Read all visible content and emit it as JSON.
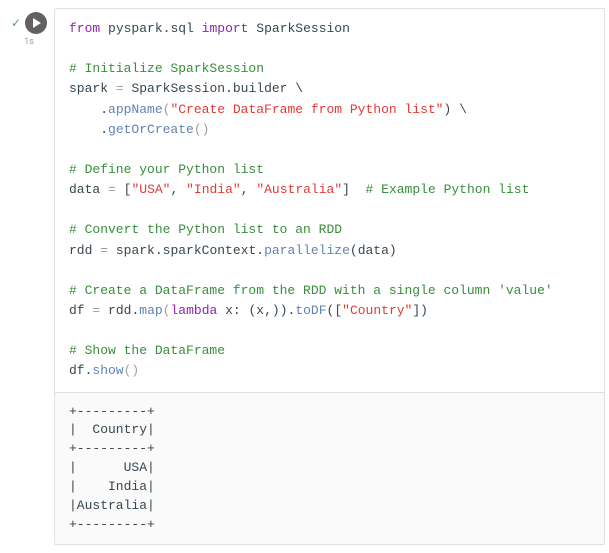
{
  "cell": {
    "exec_time": "1s",
    "code": {
      "l1": {
        "kw_from": "from",
        "mod1": "pyspark.sql",
        "kw_import": "import",
        "cls": "SparkSession"
      },
      "l3": {
        "comment": "# Initialize SparkSession"
      },
      "l4": {
        "var": "spark",
        "op": "=",
        "chain": "SparkSession.builder \\"
      },
      "l5": {
        "indent": "    .",
        "meth": "appName",
        "str": "\"Create DataFrame from Python list\"",
        "tail": ") \\"
      },
      "l6": {
        "indent": "    .",
        "meth": "getOrCreate",
        "parens": "()"
      },
      "l8": {
        "comment": "# Define your Python list"
      },
      "l9": {
        "var": "data",
        "op": "=",
        "lb": "[",
        "s1": "\"USA\"",
        "c1": ", ",
        "s2": "\"India\"",
        "c2": ", ",
        "s3": "\"Australia\"",
        "rb": "]",
        "comment": "  # Example Python list"
      },
      "l11": {
        "comment": "# Convert the Python list to an RDD"
      },
      "l12": {
        "var": "rdd",
        "op": "=",
        "obj": "spark.sparkContext.",
        "meth": "parallelize",
        "arg": "(data)"
      },
      "l14": {
        "comment": "# Create a DataFrame from the RDD with a single column 'value'"
      },
      "l15": {
        "var": "df",
        "op": "=",
        "obj": "rdd.",
        "m1": "map",
        "lp": "(",
        "kw": "lambda",
        "lam": " x: (x,)).",
        "m2": "toDF",
        "arg2": "([",
        "str": "\"Country\"",
        "arg3": "])"
      },
      "l17": {
        "comment": "# Show the DataFrame"
      },
      "l18": {
        "obj": "df.",
        "meth": "show",
        "parens": "()"
      }
    },
    "output": "+---------+\n|  Country|\n+---------+\n|      USA|\n|    India|\n|Australia|\n+---------+"
  }
}
